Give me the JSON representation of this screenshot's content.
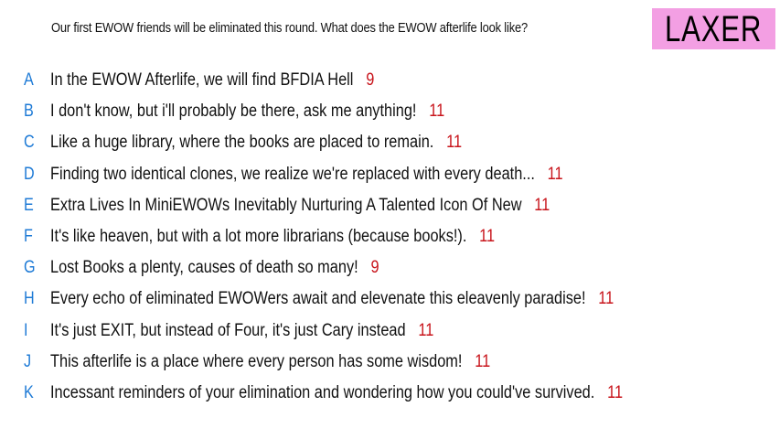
{
  "prompt": "Our first EWOW friends will be eliminated this round. What does the EWOW afterlife look like?",
  "badge": {
    "label": "LAXER",
    "background": "#f39fe3"
  },
  "colors": {
    "letter": "#1d7ad6",
    "score": "#c8141b",
    "text": "#111111"
  },
  "options": [
    {
      "letter": "A",
      "text": "In the EWOW Afterlife, we will find BFDIA Hell",
      "score": "9"
    },
    {
      "letter": "B",
      "text": "I don't know, but i'll probably be there, ask me anything!",
      "score": "11"
    },
    {
      "letter": "C",
      "text": "Like a huge library, where the books are placed to remain.",
      "score": "11"
    },
    {
      "letter": "D",
      "text": "Finding two identical clones, we realize we're replaced with every death...",
      "score": "11"
    },
    {
      "letter": "E",
      "text": "Extra Lives In MiniEWOWs Inevitably Nurturing A Talented Icon Of New",
      "score": "11"
    },
    {
      "letter": "F",
      "text": "It's like heaven, but with a lot more librarians (because books!).",
      "score": "11"
    },
    {
      "letter": "G",
      "text": "Lost Books a plenty, causes of death so many!",
      "score": "9"
    },
    {
      "letter": "H",
      "text": "Every echo of eliminated EWOWers await and elevenate this eleavenly paradise!",
      "score": "11"
    },
    {
      "letter": "I",
      "text": "It's just EXIT, but instead of Four, it's just Cary instead",
      "score": "11"
    },
    {
      "letter": "J",
      "text": "This afterlife is a place where every person has some wisdom!",
      "score": "11"
    },
    {
      "letter": "K",
      "text": "Incessant reminders of your elimination and wondering how you could've survived.",
      "score": "11"
    }
  ]
}
